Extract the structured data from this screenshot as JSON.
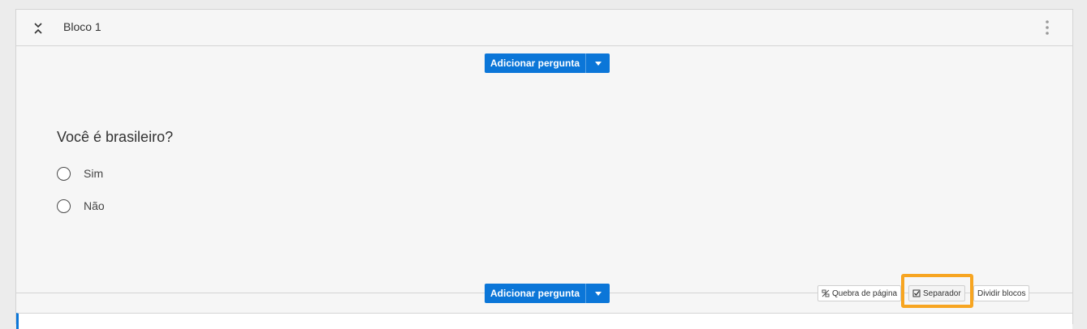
{
  "block": {
    "title": "Bloco 1",
    "collapse_icon": "collapse-chevrons-icon",
    "menu_icon": "kebab-menu-icon"
  },
  "add_question": {
    "label": "Adicionar pergunta",
    "caret_icon": "caret-down-icon"
  },
  "question": {
    "text": "Você é brasileiro?",
    "choices": [
      "Sim",
      "Não"
    ]
  },
  "footer": {
    "page_break": {
      "label": "Quebra de página",
      "icon": "page-break-icon"
    },
    "separator": {
      "label": "Separador",
      "icon": "checkbox-checked-icon",
      "highlighted": true
    },
    "split_blocks": {
      "label": "Dividir blocos"
    }
  },
  "colors": {
    "accent": "#0b76d8",
    "highlight": "#f7a521",
    "block_bg": "#f6f6f6"
  }
}
